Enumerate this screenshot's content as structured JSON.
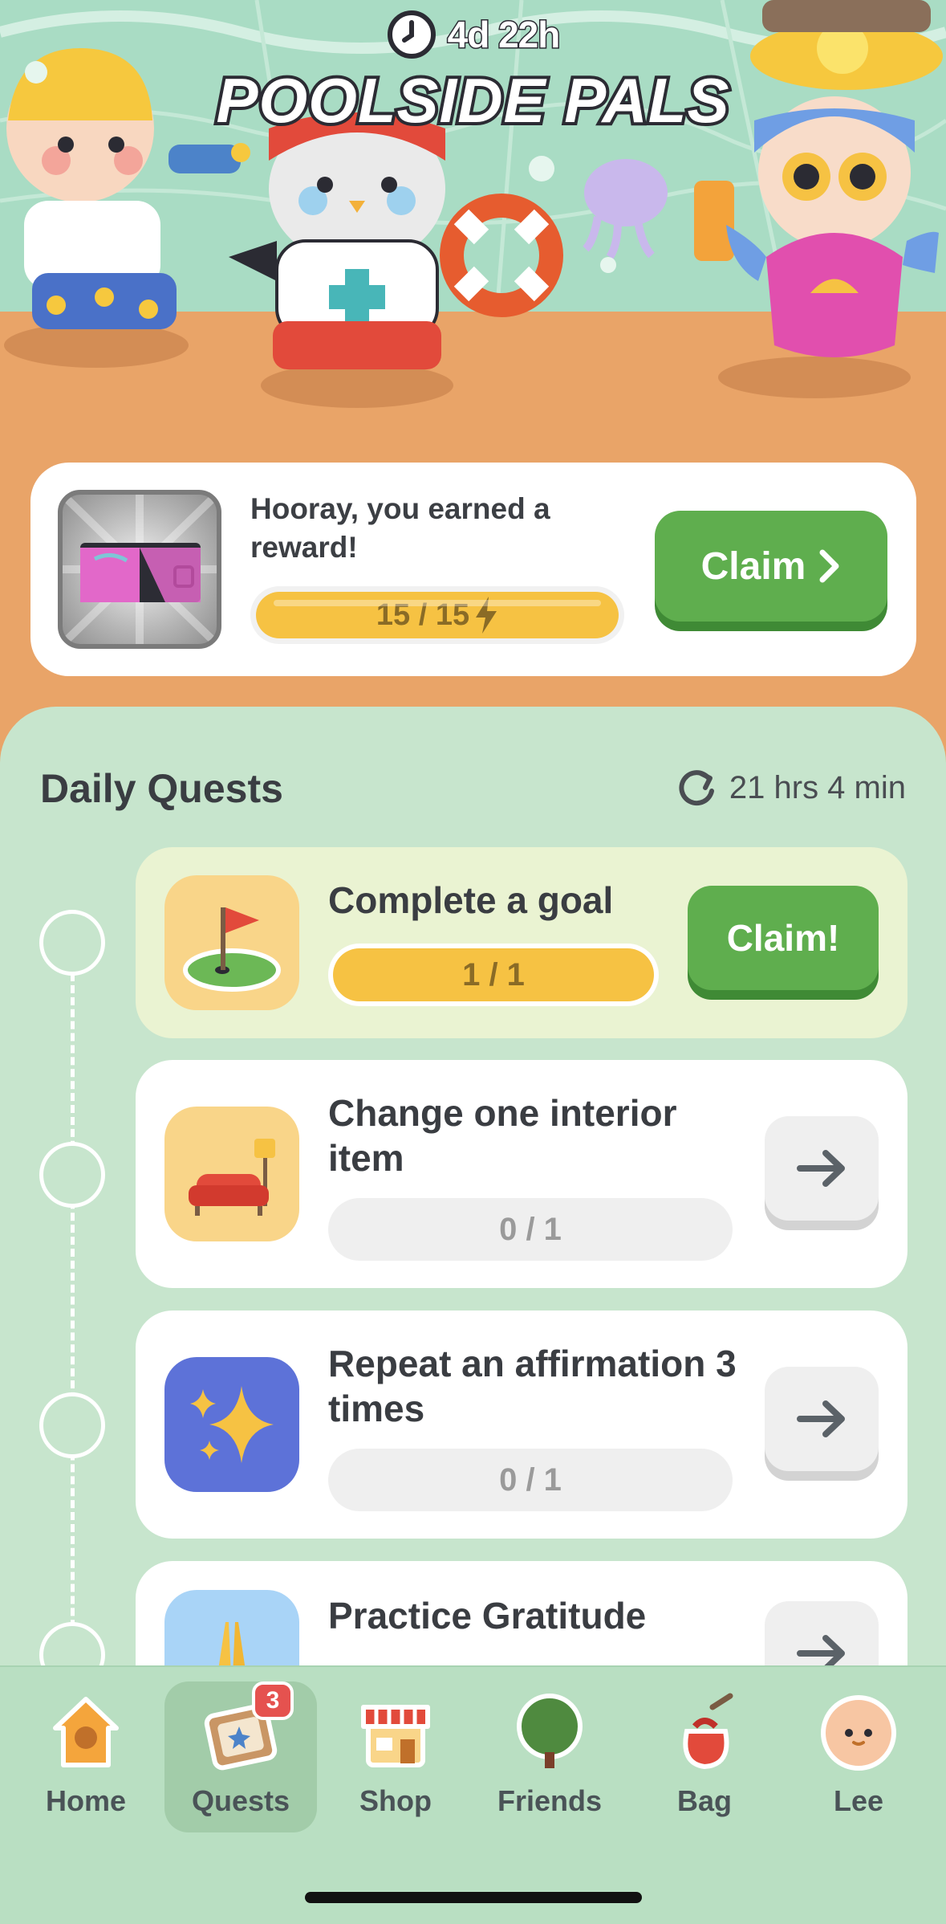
{
  "event": {
    "timer": "4d 22h",
    "title": "POOLSIDE PALS"
  },
  "reward": {
    "message": "Hooray, you earned a reward!",
    "progress_text": "15 / 15",
    "progress_fraction": 1.0,
    "claim_label": "Claim"
  },
  "daily_quests": {
    "title": "Daily Quests",
    "refresh_time": "21 hrs 4 min",
    "items": [
      {
        "title": "Complete a goal",
        "progress": "1 / 1",
        "action_label": "Claim!",
        "icon": "golf-flag-icon"
      },
      {
        "title": "Change one interior item",
        "progress": "0 / 1",
        "icon": "couch-lamp-icon"
      },
      {
        "title": "Repeat an affirmation 3 times",
        "progress": "0 / 1",
        "icon": "sparkle-icon"
      },
      {
        "title": "Practice Gratitude",
        "icon": "praying-hands-icon"
      }
    ]
  },
  "tabs": [
    {
      "label": "Home",
      "icon": "birdhouse-icon"
    },
    {
      "label": "Quests",
      "icon": "quest-board-icon",
      "badge": "3",
      "active": true
    },
    {
      "label": "Shop",
      "icon": "shop-icon"
    },
    {
      "label": "Friends",
      "icon": "tree-icon"
    },
    {
      "label": "Bag",
      "icon": "bag-icon"
    },
    {
      "label": "Lee",
      "icon": "avatar-icon"
    }
  ],
  "colors": {
    "accent_green": "#5fae4e",
    "progress_yellow": "#f6c243",
    "panel_green": "#c7e5cd",
    "hero_orange": "#e9a468",
    "badge_red": "#e5524f"
  }
}
